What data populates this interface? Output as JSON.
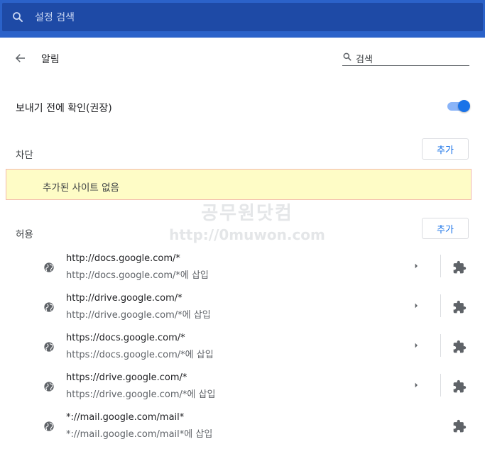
{
  "topbar": {
    "search_placeholder": "설정 검색",
    "color": "#2b62c9"
  },
  "header": {
    "title": "알림",
    "search_label": "검색"
  },
  "confirm_pref": {
    "label": "보내기 전에 확인(권장)",
    "enabled": true
  },
  "blocked": {
    "label": "차단",
    "add_label": "추가",
    "empty_text": "추가된 사이트 없음"
  },
  "allowed": {
    "label": "허용",
    "add_label": "추가",
    "sites": [
      {
        "url": "http://docs.google.com/*",
        "sub": "http://docs.google.com/*에 삽입",
        "has_arrow": true
      },
      {
        "url": "http://drive.google.com/*",
        "sub": "http://drive.google.com/*에 삽입",
        "has_arrow": true
      },
      {
        "url": "https://docs.google.com/*",
        "sub": "https://docs.google.com/*에 삽입",
        "has_arrow": true
      },
      {
        "url": "https://drive.google.com/*",
        "sub": "https://drive.google.com/*에 삽입",
        "has_arrow": true
      },
      {
        "url": "*://mail.google.com/mail*",
        "sub": "*://mail.google.com/mail*에 삽입",
        "has_arrow": false
      }
    ]
  },
  "watermark": {
    "line1": "공무원닷컴",
    "line2": "http://0muwon.com"
  },
  "icons": {
    "search": "search-icon",
    "back": "arrow-back-icon",
    "globe": "globe-icon",
    "arrow": "arrow-right-icon",
    "extension": "puzzle-extension-icon"
  },
  "colors": {
    "accent": "#1a73e8",
    "empty_bg": "#fefcc6",
    "empty_border": "#f2b8ac"
  }
}
